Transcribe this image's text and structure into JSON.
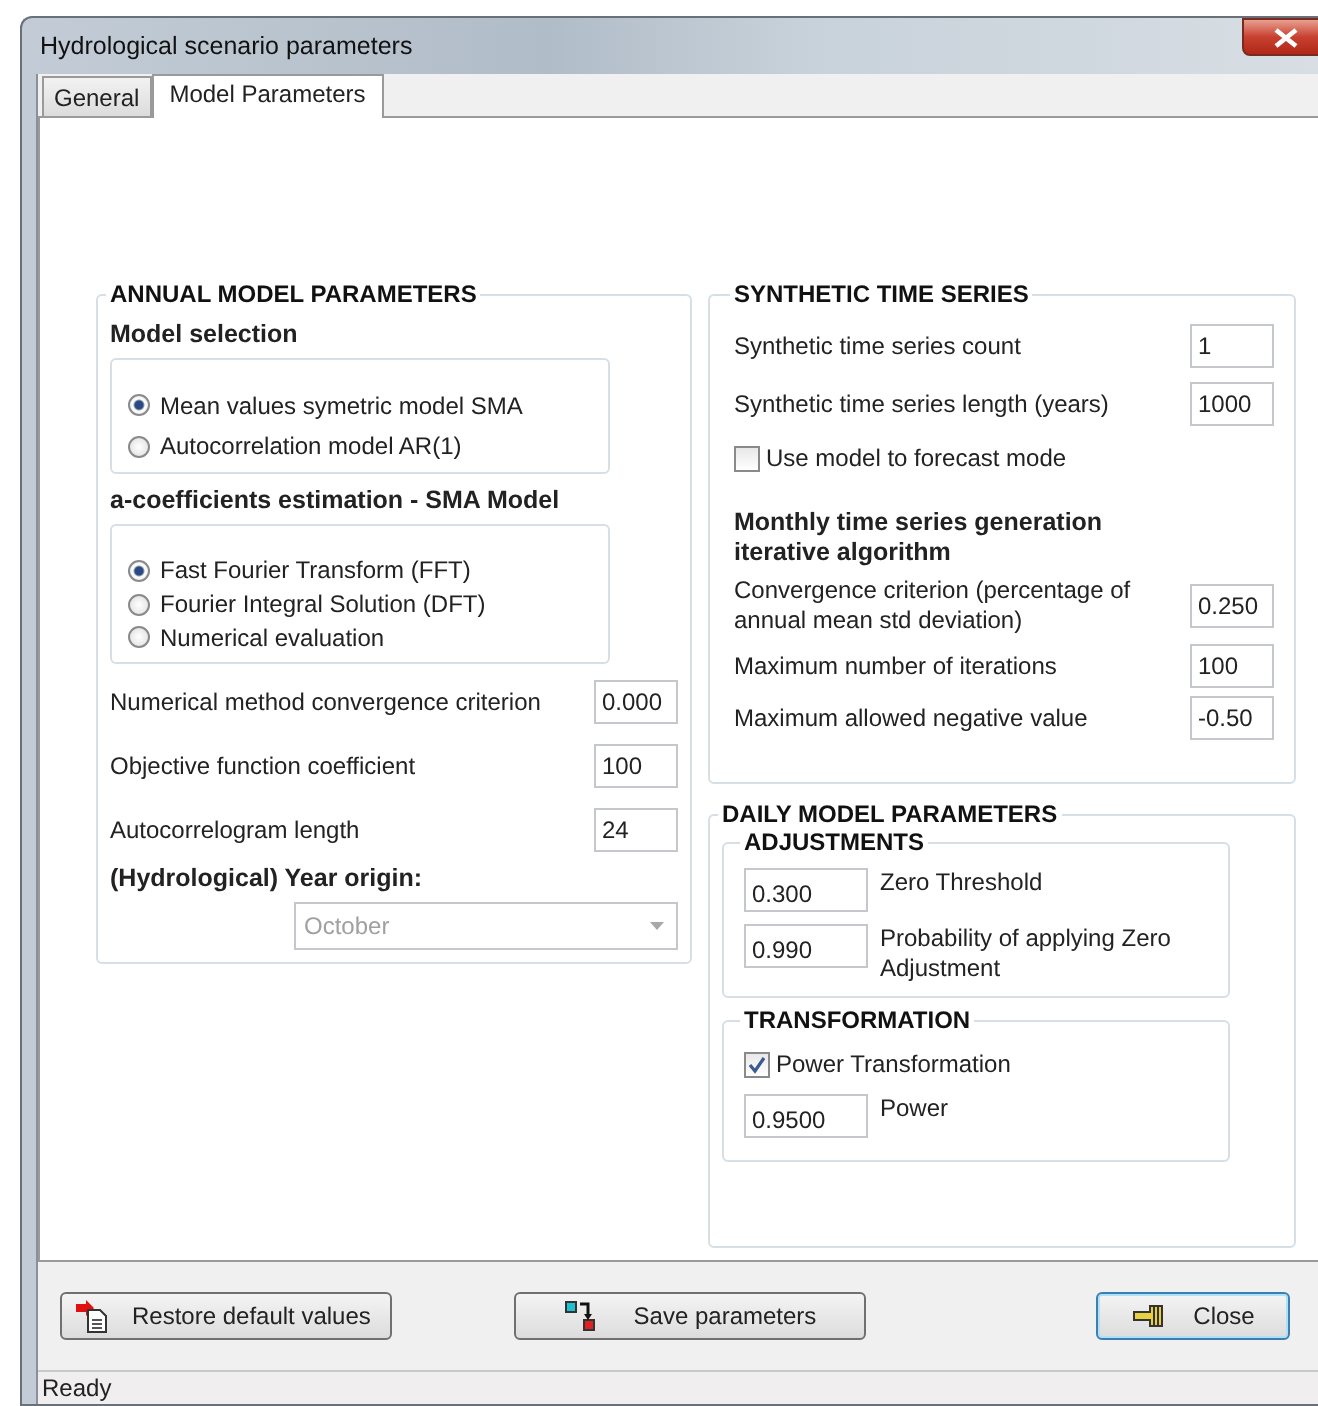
{
  "window": {
    "title": "Hydrological scenario parameters"
  },
  "tabs": [
    {
      "label": "General",
      "selected": false
    },
    {
      "label": "Model Parameters",
      "selected": true
    }
  ],
  "annual": {
    "title": "ANNUAL MODEL PARAMETERS",
    "model_selection": {
      "title": "Model selection",
      "options": [
        {
          "label": "Mean values symetric model SMA",
          "selected": true
        },
        {
          "label": "Autocorrelation model AR(1)",
          "selected": false
        }
      ]
    },
    "coefficients": {
      "title": "a-coefficients estimation - SMA Model",
      "options": [
        {
          "label": "Fast Fourier Transform (FFT)",
          "selected": true
        },
        {
          "label": "Fourier Integral Solution (DFT)",
          "selected": false
        },
        {
          "label": "Numerical evaluation",
          "selected": false
        }
      ]
    },
    "fields": [
      {
        "label": "Numerical method convergence criterion",
        "value": "0.000"
      },
      {
        "label": "Objective function coefficient",
        "value": "100"
      },
      {
        "label": "Autocorrelogram length",
        "value": "24"
      }
    ],
    "year_origin": {
      "label": "(Hydrological) Year origin:",
      "value": "October",
      "disabled": true
    }
  },
  "synthetic": {
    "title": "SYNTHETIC TIME SERIES",
    "fields": [
      {
        "label": "Synthetic time series count",
        "value": "1"
      },
      {
        "label": "Synthetic time series length (years)",
        "value": "1000"
      }
    ],
    "forecast": {
      "label": "Use model to forecast mode",
      "checked": false
    },
    "iterative": {
      "title": "Monthly time series generation iterative algorithm",
      "fields": [
        {
          "label": "Convergence criterion (percentage of annual mean std deviation)",
          "value": "0.250"
        },
        {
          "label": "Maximum number of iterations",
          "value": "100"
        },
        {
          "label": "Maximum allowed negative value",
          "value": "-0.50"
        }
      ]
    }
  },
  "daily": {
    "title": "DAILY MODEL PARAMETERS",
    "adjustments": {
      "title": "ADJUSTMENTS",
      "fields": [
        {
          "value": "0.300",
          "label": "Zero Threshold"
        },
        {
          "value": "0.990",
          "label": "Probability of applying Zero Adjustment"
        }
      ]
    },
    "transformation": {
      "title": "TRANSFORMATION",
      "power": {
        "label": "Power Transformation",
        "checked": true
      },
      "fields": [
        {
          "value": "0.9500",
          "label": "Power"
        }
      ]
    }
  },
  "buttons": [
    {
      "label": "Restore default values",
      "kind": "restore",
      "focused": false
    },
    {
      "label": "Save parameters",
      "kind": "save",
      "focused": false
    },
    {
      "label": "Close",
      "kind": "close",
      "focused": true
    }
  ],
  "status_bar": "Ready"
}
